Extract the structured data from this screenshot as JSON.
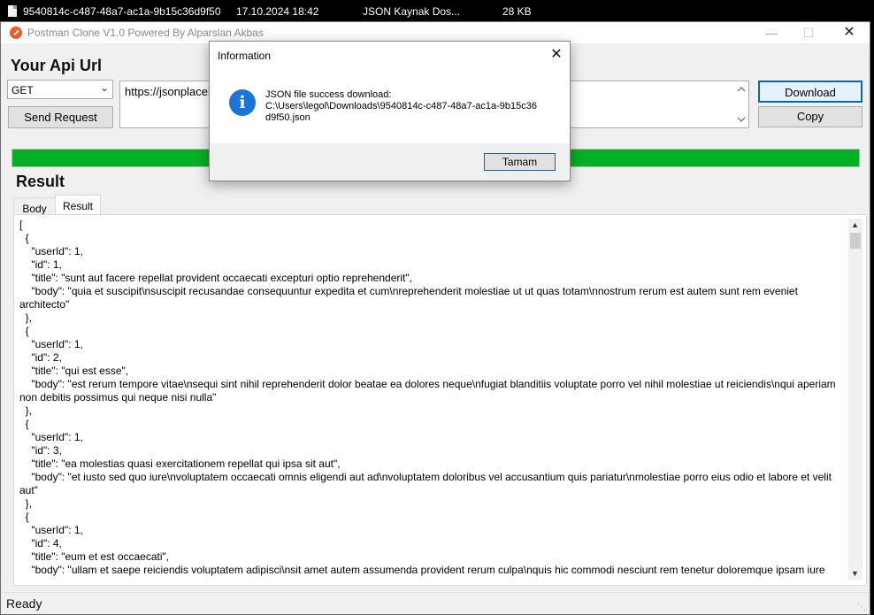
{
  "explorer_row": {
    "filename": "9540814c-c487-48a7-ac1a-9b15c36d9f50",
    "date": "17.10.2024 18:42",
    "type": "JSON Kaynak Dos...",
    "size": "28 KB"
  },
  "window": {
    "title": "Postman Clone V1.0 Powered By Alparslan Akbas",
    "minimize": "—",
    "maximize": "☐",
    "close": "✕"
  },
  "request": {
    "heading": "Your Api Url",
    "method": "GET",
    "url": "https://jsonplaceholder.typicode.com/posts",
    "send_label": "Send Request",
    "download_label": "Download",
    "copy_label": "Copy"
  },
  "progress": {
    "value_percent": 100,
    "color": "#06b025"
  },
  "result": {
    "heading": "Result",
    "tabs": [
      {
        "label": "Body"
      },
      {
        "label": "Result"
      }
    ],
    "active_tab": "Result",
    "content": "[\n  {\n    \"userId\": 1,\n    \"id\": 1,\n    \"title\": \"sunt aut facere repellat provident occaecati excepturi optio reprehenderit\",\n    \"body\": \"quia et suscipit\\nsuscipit recusandae consequuntur expedita et cum\\nreprehenderit molestiae ut ut quas totam\\nnostrum rerum est autem sunt rem eveniet architecto\"\n  },\n  {\n    \"userId\": 1,\n    \"id\": 2,\n    \"title\": \"qui est esse\",\n    \"body\": \"est rerum tempore vitae\\nsequi sint nihil reprehenderit dolor beatae ea dolores neque\\nfugiat blanditiis voluptate porro vel nihil molestiae ut reiciendis\\nqui aperiam non debitis possimus qui neque nisi nulla\"\n  },\n  {\n    \"userId\": 1,\n    \"id\": 3,\n    \"title\": \"ea molestias quasi exercitationem repellat qui ipsa sit aut\",\n    \"body\": \"et iusto sed quo iure\\nvoluptatem occaecati omnis eligendi aut ad\\nvoluptatem doloribus vel accusantium quis pariatur\\nmolestiae porro eius odio et labore et velit aut\"\n  },\n  {\n    \"userId\": 1,\n    \"id\": 4,\n    \"title\": \"eum et est occaecati\",\n    \"body\": \"ullam et saepe reiciendis voluptatem adipisci\\nsit amet autem assumenda provident rerum culpa\\nquis hic commodi nesciunt rem tenetur doloremque ipsam iure"
  },
  "status": {
    "text": "Ready"
  },
  "dialog": {
    "title": "Information",
    "close": "✕",
    "icon": "info-icon",
    "icon_glyph": "i",
    "message": "JSON file success download:\nC:\\Users\\legol\\Downloads\\9540814c-c487-48a7-ac1a-9b15c36\nd9f50.json",
    "ok_label": "Tamam"
  }
}
